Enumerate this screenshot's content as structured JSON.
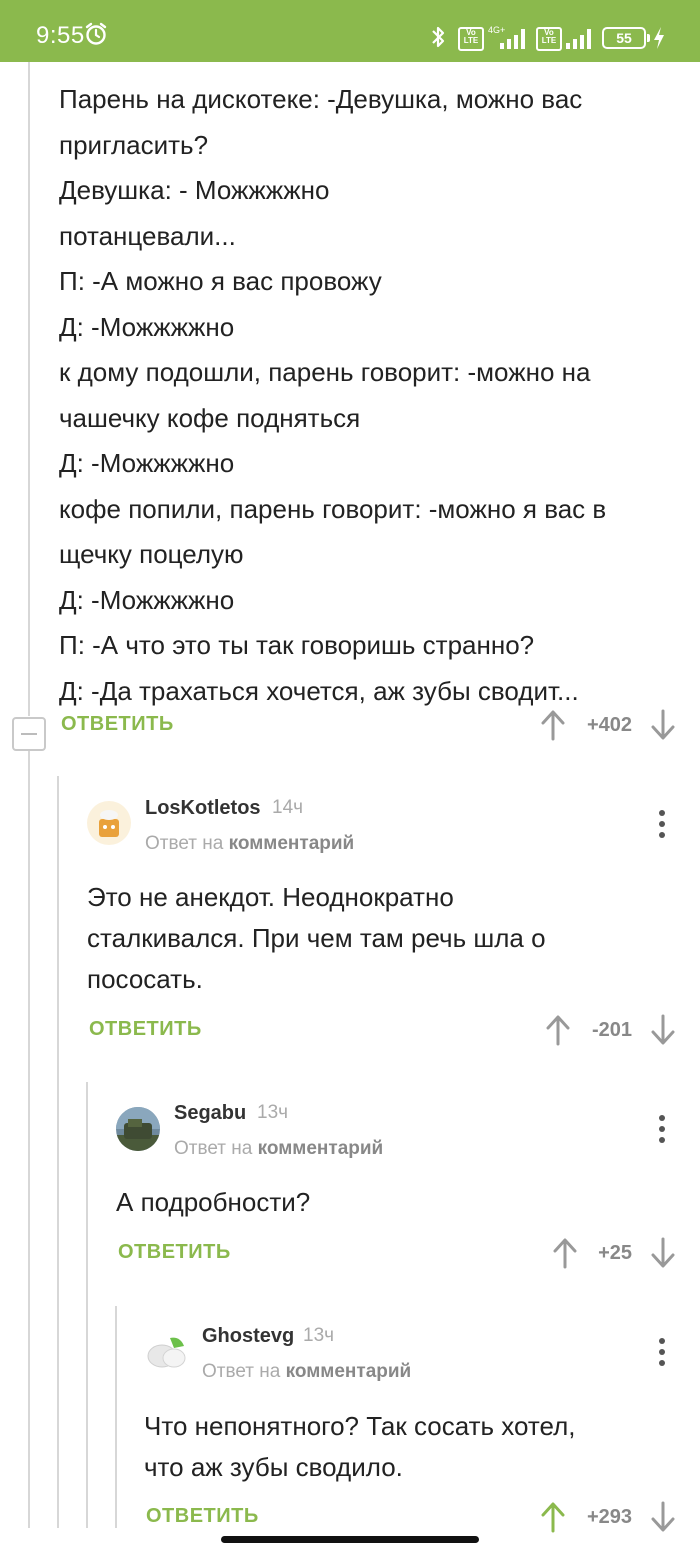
{
  "status_bar": {
    "time": "9:55",
    "network": "4G+",
    "battery": "55"
  },
  "colors": {
    "accent": "#8bb94d",
    "upvote_active": "#8bb94d"
  },
  "post": {
    "lines": [
      "Парень на дискотеке: -Девушка, можно вас",
      "пригласить?",
      "Девушка: - Можжжжно",
      "потанцевали...",
      "П: -А можно я вас провожу",
      "Д: -Можжжжно",
      "к дому подошли, парень говорит: -можно на",
      "чашечку кофе подняться",
      "Д: -Можжжжно",
      "кофе попили, парень говорит: -можно я вас в",
      "щечку поцелую",
      "Д: -Можжжжно",
      "П: -А что это ты так говоришь странно?",
      "Д: -Да трахаться хочется, аж зубы сводит..."
    ],
    "reply_label": "ОТВЕТИТЬ",
    "score": "+402"
  },
  "comments": [
    {
      "username": "LosKotletos",
      "time": "14ч",
      "reply_prefix": "Ответ на",
      "reply_target": "комментарий",
      "lines": [
        "Это не анекдот. Неоднократно",
        "сталкивался. При чем там речь шла о",
        "пососать."
      ],
      "reply_label": "ОТВЕТИТЬ",
      "score": "-201"
    },
    {
      "username": "Segabu",
      "time": "13ч",
      "reply_prefix": "Ответ на",
      "reply_target": "комментарий",
      "lines": [
        "А подробности?"
      ],
      "reply_label": "ОТВЕТИТЬ",
      "score": "+25"
    },
    {
      "username": "Ghostevg",
      "time": "13ч",
      "reply_prefix": "Ответ на",
      "reply_target": "комментарий",
      "lines": [
        "Что непонятного? Так сосать хотел,",
        "что аж зубы сводило."
      ],
      "reply_label": "ОТВЕТИТЬ",
      "score": "+293"
    }
  ]
}
